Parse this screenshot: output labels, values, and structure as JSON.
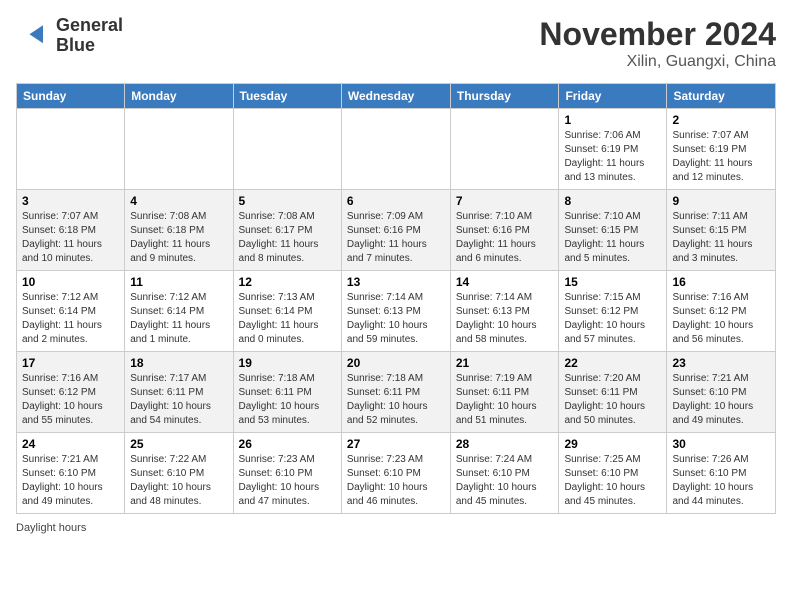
{
  "header": {
    "logo_line1": "General",
    "logo_line2": "Blue",
    "month_title": "November 2024",
    "location": "Xilin, Guangxi, China"
  },
  "days_of_week": [
    "Sunday",
    "Monday",
    "Tuesday",
    "Wednesday",
    "Thursday",
    "Friday",
    "Saturday"
  ],
  "weeks": [
    [
      {
        "day": "",
        "info": ""
      },
      {
        "day": "",
        "info": ""
      },
      {
        "day": "",
        "info": ""
      },
      {
        "day": "",
        "info": ""
      },
      {
        "day": "",
        "info": ""
      },
      {
        "day": "1",
        "info": "Sunrise: 7:06 AM\nSunset: 6:19 PM\nDaylight: 11 hours and 13 minutes."
      },
      {
        "day": "2",
        "info": "Sunrise: 7:07 AM\nSunset: 6:19 PM\nDaylight: 11 hours and 12 minutes."
      }
    ],
    [
      {
        "day": "3",
        "info": "Sunrise: 7:07 AM\nSunset: 6:18 PM\nDaylight: 11 hours and 10 minutes."
      },
      {
        "day": "4",
        "info": "Sunrise: 7:08 AM\nSunset: 6:18 PM\nDaylight: 11 hours and 9 minutes."
      },
      {
        "day": "5",
        "info": "Sunrise: 7:08 AM\nSunset: 6:17 PM\nDaylight: 11 hours and 8 minutes."
      },
      {
        "day": "6",
        "info": "Sunrise: 7:09 AM\nSunset: 6:16 PM\nDaylight: 11 hours and 7 minutes."
      },
      {
        "day": "7",
        "info": "Sunrise: 7:10 AM\nSunset: 6:16 PM\nDaylight: 11 hours and 6 minutes."
      },
      {
        "day": "8",
        "info": "Sunrise: 7:10 AM\nSunset: 6:15 PM\nDaylight: 11 hours and 5 minutes."
      },
      {
        "day": "9",
        "info": "Sunrise: 7:11 AM\nSunset: 6:15 PM\nDaylight: 11 hours and 3 minutes."
      }
    ],
    [
      {
        "day": "10",
        "info": "Sunrise: 7:12 AM\nSunset: 6:14 PM\nDaylight: 11 hours and 2 minutes."
      },
      {
        "day": "11",
        "info": "Sunrise: 7:12 AM\nSunset: 6:14 PM\nDaylight: 11 hours and 1 minute."
      },
      {
        "day": "12",
        "info": "Sunrise: 7:13 AM\nSunset: 6:14 PM\nDaylight: 11 hours and 0 minutes."
      },
      {
        "day": "13",
        "info": "Sunrise: 7:14 AM\nSunset: 6:13 PM\nDaylight: 10 hours and 59 minutes."
      },
      {
        "day": "14",
        "info": "Sunrise: 7:14 AM\nSunset: 6:13 PM\nDaylight: 10 hours and 58 minutes."
      },
      {
        "day": "15",
        "info": "Sunrise: 7:15 AM\nSunset: 6:12 PM\nDaylight: 10 hours and 57 minutes."
      },
      {
        "day": "16",
        "info": "Sunrise: 7:16 AM\nSunset: 6:12 PM\nDaylight: 10 hours and 56 minutes."
      }
    ],
    [
      {
        "day": "17",
        "info": "Sunrise: 7:16 AM\nSunset: 6:12 PM\nDaylight: 10 hours and 55 minutes."
      },
      {
        "day": "18",
        "info": "Sunrise: 7:17 AM\nSunset: 6:11 PM\nDaylight: 10 hours and 54 minutes."
      },
      {
        "day": "19",
        "info": "Sunrise: 7:18 AM\nSunset: 6:11 PM\nDaylight: 10 hours and 53 minutes."
      },
      {
        "day": "20",
        "info": "Sunrise: 7:18 AM\nSunset: 6:11 PM\nDaylight: 10 hours and 52 minutes."
      },
      {
        "day": "21",
        "info": "Sunrise: 7:19 AM\nSunset: 6:11 PM\nDaylight: 10 hours and 51 minutes."
      },
      {
        "day": "22",
        "info": "Sunrise: 7:20 AM\nSunset: 6:11 PM\nDaylight: 10 hours and 50 minutes."
      },
      {
        "day": "23",
        "info": "Sunrise: 7:21 AM\nSunset: 6:10 PM\nDaylight: 10 hours and 49 minutes."
      }
    ],
    [
      {
        "day": "24",
        "info": "Sunrise: 7:21 AM\nSunset: 6:10 PM\nDaylight: 10 hours and 49 minutes."
      },
      {
        "day": "25",
        "info": "Sunrise: 7:22 AM\nSunset: 6:10 PM\nDaylight: 10 hours and 48 minutes."
      },
      {
        "day": "26",
        "info": "Sunrise: 7:23 AM\nSunset: 6:10 PM\nDaylight: 10 hours and 47 minutes."
      },
      {
        "day": "27",
        "info": "Sunrise: 7:23 AM\nSunset: 6:10 PM\nDaylight: 10 hours and 46 minutes."
      },
      {
        "day": "28",
        "info": "Sunrise: 7:24 AM\nSunset: 6:10 PM\nDaylight: 10 hours and 45 minutes."
      },
      {
        "day": "29",
        "info": "Sunrise: 7:25 AM\nSunset: 6:10 PM\nDaylight: 10 hours and 45 minutes."
      },
      {
        "day": "30",
        "info": "Sunrise: 7:26 AM\nSunset: 6:10 PM\nDaylight: 10 hours and 44 minutes."
      }
    ]
  ],
  "footer": {
    "daylight_hours_label": "Daylight hours"
  }
}
